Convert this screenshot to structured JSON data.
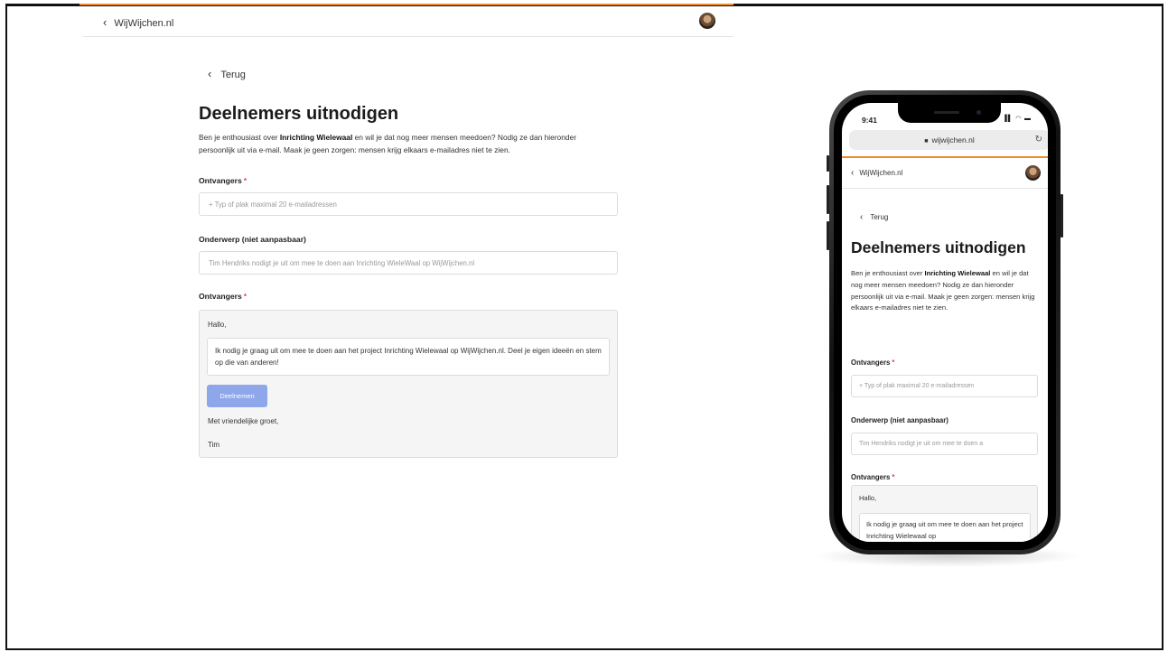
{
  "desktop": {
    "header": {
      "back_label": "WijWijchen.nl"
    },
    "back_link": "Terug",
    "title": "Deelnemers uitnodigen",
    "intro": {
      "part1": "Ben je enthousiast over ",
      "project": "Inrichting Wielewaal",
      "part2": " en wil je dat nog meer mensen meedoen? Nodig ze dan hieronder persoonlijk uit via e-mail. Maak je geen zorgen: mensen krijg elkaars e-mailadres niet te zien."
    },
    "recipients_label": "Ontvangers",
    "required_mark": "*",
    "recipients_placeholder": "+ Typ of plak maximal 20 e-mailadressen",
    "subject_label": "Onderwerp (niet aanpasbaar)",
    "subject_value": "Tim Hendriks nodigt je uit om mee te doen aan Inrichting WieleWaal op WijWijchen.nl",
    "message_label": "Ontvangers",
    "message": {
      "greeting": "Hallo,",
      "body": "Ik nodig je graag uit om mee te doen aan het project Inrichting Wielewaal op WijWijchen.nl. Deel je eigen ideeën en stem op die van anderen!",
      "button": "Deelnemen",
      "closing": "Met vriendelijke groet,",
      "signature": "Tim"
    }
  },
  "phone": {
    "status_time": "9:41",
    "url": "wijwijchen.nl",
    "header": {
      "back_label": "WijWijchen.nl"
    },
    "back_link": "Terug",
    "title": "Deelnemers uitnodigen",
    "intro": {
      "part1": "Ben je enthousiast over ",
      "project": "Inrichting Wielewaal",
      "part2": " en wil je dat nog meer mensen meedoen? Nodig ze dan hieronder persoonlijk uit via e-mail. Maak je geen zorgen: mensen krijg elkaars e-mailadres niet te zien."
    },
    "recipients_label": "Ontvangers",
    "required_mark": "*",
    "recipients_placeholder": "+ Typ of plak maximal 20 e-mailadressen",
    "subject_label": "Onderwerp (niet aanpasbaar)",
    "subject_value": "Tim Hendriks nodigt je uit om mee te doen a",
    "message_label": "Ontvangers",
    "message": {
      "greeting": "Hallo,",
      "body": "Ik nodig je graag uit om mee te doen aan het project Inrichting Wielewaal op"
    }
  },
  "colors": {
    "accent": "#f08a2c",
    "primary_button": "#8ea7ea",
    "required": "#e0474c"
  },
  "icons": [
    "chevron-left-icon",
    "lock-icon",
    "reload-icon",
    "signal-icon",
    "wifi-icon",
    "battery-icon"
  ]
}
